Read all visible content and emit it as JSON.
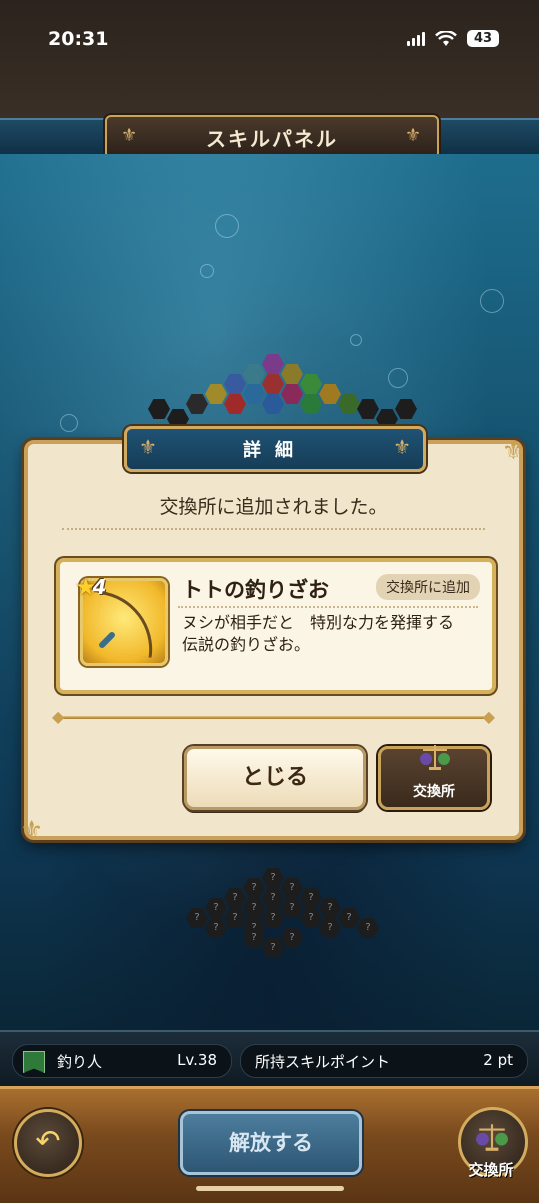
{
  "status_bar": {
    "time": "20:31",
    "battery": "43"
  },
  "header": {
    "title": "スキルパネル"
  },
  "dialog": {
    "title": "詳細",
    "message": "交換所に追加されました。",
    "item": {
      "rarity": "4",
      "name": "トトの釣りざお",
      "badge": "交換所に追加",
      "description_line1": "ヌシが相手だと　特別な力を発揮する",
      "description_line2": "伝説の釣りざお。"
    },
    "close_button": "とじる",
    "exchange_button": "交換所"
  },
  "info": {
    "job_name": "釣り人",
    "job_level": "Lv.38",
    "skill_points_label": "所持スキルポイント",
    "skill_points_value": "2 pt"
  },
  "footer": {
    "release_button": "解放する",
    "exchange_label": "交換所"
  }
}
